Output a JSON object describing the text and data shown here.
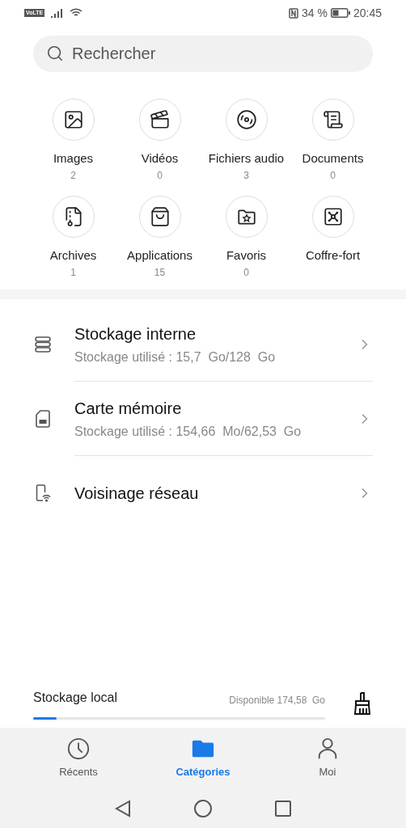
{
  "status_bar": {
    "network_badge": "VoLTE",
    "battery": "34 %",
    "time": "20:45"
  },
  "search": {
    "placeholder": "Rechercher"
  },
  "categories": [
    {
      "kind": "image",
      "label": "Images",
      "count": "2"
    },
    {
      "kind": "video",
      "label": "Vidéos",
      "count": "0"
    },
    {
      "kind": "audio",
      "label": "Fichiers audio",
      "count": "3"
    },
    {
      "kind": "document",
      "label": "Documents",
      "count": "0"
    },
    {
      "kind": "archive",
      "label": "Archives",
      "count": "1"
    },
    {
      "kind": "app",
      "label": "Applications",
      "count": "15"
    },
    {
      "kind": "favorite",
      "label": "Favoris",
      "count": "0"
    },
    {
      "kind": "safe",
      "label": "Coffre-fort"
    }
  ],
  "storage": [
    {
      "kind": "internal",
      "title": "Stockage interne",
      "subtitle": "Stockage utilisé : 15,7  Go/128  Go"
    },
    {
      "kind": "sdcard",
      "title": "Carte mémoire",
      "subtitle": "Stockage utilisé : 154,66  Mo/62,53  Go"
    },
    {
      "kind": "network",
      "title": "Voisinage réseau"
    }
  ],
  "local_storage": {
    "title": "Stockage local",
    "available": "Disponible 174,58  Go",
    "level": 0.08
  },
  "bottom_nav": [
    {
      "kind": "recent",
      "label": "Récents",
      "selected": false
    },
    {
      "kind": "categories",
      "label": "Catégories",
      "selected": true
    },
    {
      "kind": "me",
      "label": "Moi",
      "selected": false
    }
  ]
}
